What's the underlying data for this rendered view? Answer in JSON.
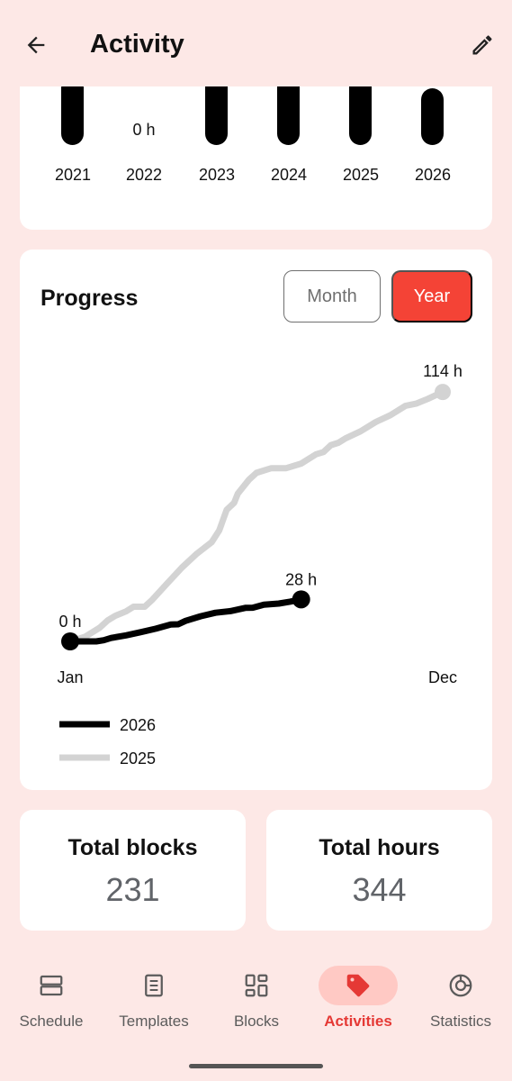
{
  "header": {
    "title": "Activity",
    "back_icon": "arrow-left-icon",
    "edit_icon": "pencil-icon"
  },
  "years_card": {
    "years": [
      "2021",
      "2022",
      "2023",
      "2024",
      "2025",
      "2026"
    ],
    "zero_label": "0 h"
  },
  "progress_card": {
    "title": "Progress",
    "toggle": {
      "month_label": "Month",
      "year_label": "Year",
      "selected": "Year"
    }
  },
  "chart_data": {
    "type": "line",
    "x_start_label": "Jan",
    "x_end_label": "Dec",
    "series": [
      {
        "name": "2026",
        "color": "#000000",
        "end_label": "28 h",
        "start_label": "0 h",
        "x": [
          0,
          0.03,
          0.07,
          0.09,
          0.11,
          0.15,
          0.19,
          0.23,
          0.27,
          0.29,
          0.31,
          0.35,
          0.39,
          0.43,
          0.47,
          0.49,
          0.52,
          0.56,
          0.59,
          0.62
        ],
        "values": [
          0,
          0,
          0,
          0.5,
          1.5,
          2.6,
          4.0,
          5.5,
          7.3,
          7.4,
          8.9,
          10.9,
          12.4,
          13.1,
          14.5,
          14.6,
          15.9,
          16.4,
          17.2,
          18.2
        ]
      },
      {
        "name": "2025",
        "color": "#d3d3d3",
        "end_label": "114 h",
        "x": [
          0,
          0.04,
          0.08,
          0.1,
          0.12,
          0.15,
          0.17,
          0.2,
          0.22,
          0.26,
          0.3,
          0.34,
          0.38,
          0.4,
          0.42,
          0.44,
          0.45,
          0.48,
          0.5,
          0.54,
          0.58,
          0.62,
          0.66,
          0.68,
          0.7,
          0.72,
          0.74,
          0.78,
          0.82,
          0.86,
          0.9,
          0.93,
          0.96,
          1.0
        ],
        "values": [
          0,
          2,
          6,
          9,
          11,
          13,
          15,
          15,
          18,
          25,
          32,
          38,
          43,
          48,
          57,
          60,
          64,
          70,
          73,
          75,
          75,
          77,
          81,
          82,
          85,
          86,
          88,
          91,
          95,
          98,
          102,
          103,
          105,
          108
        ]
      }
    ],
    "legend": [
      "2026",
      "2025"
    ],
    "legend_placement": "bottom-left"
  },
  "stats": [
    {
      "title": "Total blocks",
      "value": "231"
    },
    {
      "title": "Total hours",
      "value": "344"
    }
  ],
  "nav": [
    {
      "label": "Schedule",
      "icon": "schedule-icon",
      "active": false
    },
    {
      "label": "Templates",
      "icon": "templates-icon",
      "active": false
    },
    {
      "label": "Blocks",
      "icon": "blocks-icon",
      "active": false
    },
    {
      "label": "Activities",
      "icon": "tag-icon",
      "active": true
    },
    {
      "label": "Statistics",
      "icon": "statistics-icon",
      "active": false
    }
  ]
}
